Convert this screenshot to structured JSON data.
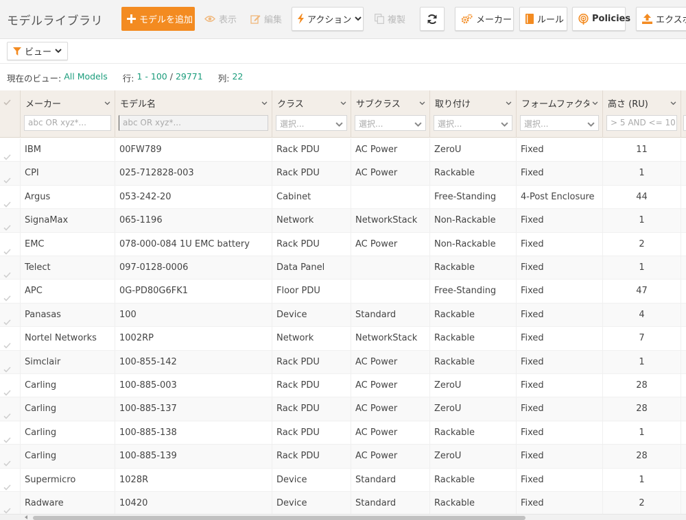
{
  "app": {
    "title": "モデルライブラリ"
  },
  "toolbar": {
    "add_model": "モデルを追加",
    "show": "表示",
    "edit": "編集",
    "actions": "アクション",
    "copy": "複製",
    "maker": "メーカー",
    "rules": "ルール",
    "policies": "Policies",
    "export": "エクスポ"
  },
  "viewbar": {
    "view_label": "ビュー"
  },
  "info": {
    "current_view_label": "現在のビュー:",
    "current_view": "All Models",
    "rows_label": "行:",
    "rows_range": "1 - 100",
    "slash": "/",
    "rows_total": "29771",
    "cols_label": "列:",
    "cols_count": "22"
  },
  "columns": [
    {
      "key": "maker",
      "label": "メーカー",
      "filter": "abc OR xyz*...",
      "filter_type": "text"
    },
    {
      "key": "model",
      "label": "モデル名",
      "filter": "abc OR xyz*...",
      "filter_type": "text-active"
    },
    {
      "key": "class",
      "label": "クラス",
      "filter": "選択...",
      "filter_type": "select"
    },
    {
      "key": "subclass",
      "label": "サブクラス",
      "filter": "選択...",
      "filter_type": "select"
    },
    {
      "key": "mount",
      "label": "取り付け",
      "filter": "選択...",
      "filter_type": "select"
    },
    {
      "key": "form",
      "label": "フォームファクター",
      "filter": "選択...",
      "filter_type": "select"
    },
    {
      "key": "height",
      "label": "高さ (RU)",
      "filter": "> 5 AND <= 10",
      "filter_type": "text"
    }
  ],
  "rows": [
    {
      "maker": "IBM",
      "model": "00FW789",
      "class": "Rack PDU",
      "subclass": "AC Power",
      "mount": "ZeroU",
      "form": "Fixed",
      "height": "11"
    },
    {
      "maker": "CPI",
      "model": "025-712828-003",
      "class": "Rack PDU",
      "subclass": "AC Power",
      "mount": "Rackable",
      "form": "Fixed",
      "height": "1"
    },
    {
      "maker": "Argus",
      "model": "053-242-20",
      "class": "Cabinet",
      "subclass": "",
      "mount": "Free-Standing",
      "form": "4-Post Enclosure",
      "height": "44"
    },
    {
      "maker": "SignaMax",
      "model": "065-1196",
      "class": "Network",
      "subclass": "NetworkStack",
      "mount": "Non-Rackable",
      "form": "Fixed",
      "height": "1"
    },
    {
      "maker": "EMC",
      "model": "078-000-084 1U EMC battery",
      "class": "Rack PDU",
      "subclass": "AC Power",
      "mount": "Non-Rackable",
      "form": "Fixed",
      "height": "2"
    },
    {
      "maker": "Telect",
      "model": "097-0128-0006",
      "class": "Data Panel",
      "subclass": "",
      "mount": "Rackable",
      "form": "Fixed",
      "height": "1"
    },
    {
      "maker": "APC",
      "model": "0G-PD80G6FK1",
      "class": "Floor PDU",
      "subclass": "",
      "mount": "Free-Standing",
      "form": "Fixed",
      "height": "47"
    },
    {
      "maker": "Panasas",
      "model": "100",
      "class": "Device",
      "subclass": "Standard",
      "mount": "Rackable",
      "form": "Fixed",
      "height": "4"
    },
    {
      "maker": "Nortel Networks",
      "model": "1002RP",
      "class": "Network",
      "subclass": "NetworkStack",
      "mount": "Rackable",
      "form": "Fixed",
      "height": "7"
    },
    {
      "maker": "Simclair",
      "model": "100-855-142",
      "class": "Rack PDU",
      "subclass": "AC Power",
      "mount": "Rackable",
      "form": "Fixed",
      "height": "1"
    },
    {
      "maker": "Carling",
      "model": "100-885-003",
      "class": "Rack PDU",
      "subclass": "AC Power",
      "mount": "ZeroU",
      "form": "Fixed",
      "height": "28"
    },
    {
      "maker": "Carling",
      "model": "100-885-137",
      "class": "Rack PDU",
      "subclass": "AC Power",
      "mount": "ZeroU",
      "form": "Fixed",
      "height": "28"
    },
    {
      "maker": "Carling",
      "model": "100-885-138",
      "class": "Rack PDU",
      "subclass": "AC Power",
      "mount": "Rackable",
      "form": "Fixed",
      "height": "1"
    },
    {
      "maker": "Carling",
      "model": "100-885-139",
      "class": "Rack PDU",
      "subclass": "AC Power",
      "mount": "ZeroU",
      "form": "Fixed",
      "height": "28"
    },
    {
      "maker": "Supermicro",
      "model": "1028R",
      "class": "Device",
      "subclass": "Standard",
      "mount": "Rackable",
      "form": "Fixed",
      "height": "1"
    },
    {
      "maker": "Radware",
      "model": "10420",
      "class": "Device",
      "subclass": "Standard",
      "mount": "Rackable",
      "form": "Fixed",
      "height": "2"
    }
  ],
  "icons": {
    "add": "plus-icon",
    "show": "eye-icon",
    "edit": "pencil-icon",
    "actions": "bolt-icon",
    "copy": "copy-icon",
    "refresh": "refresh-icon",
    "maker": "cogs-icon",
    "rules": "book-icon",
    "policies": "podcast-icon",
    "export": "upload-icon",
    "view": "filter-icon"
  },
  "colors": {
    "accent": "#f38b21",
    "link": "#1a9c7b",
    "header_bg": "#f3eee8"
  }
}
